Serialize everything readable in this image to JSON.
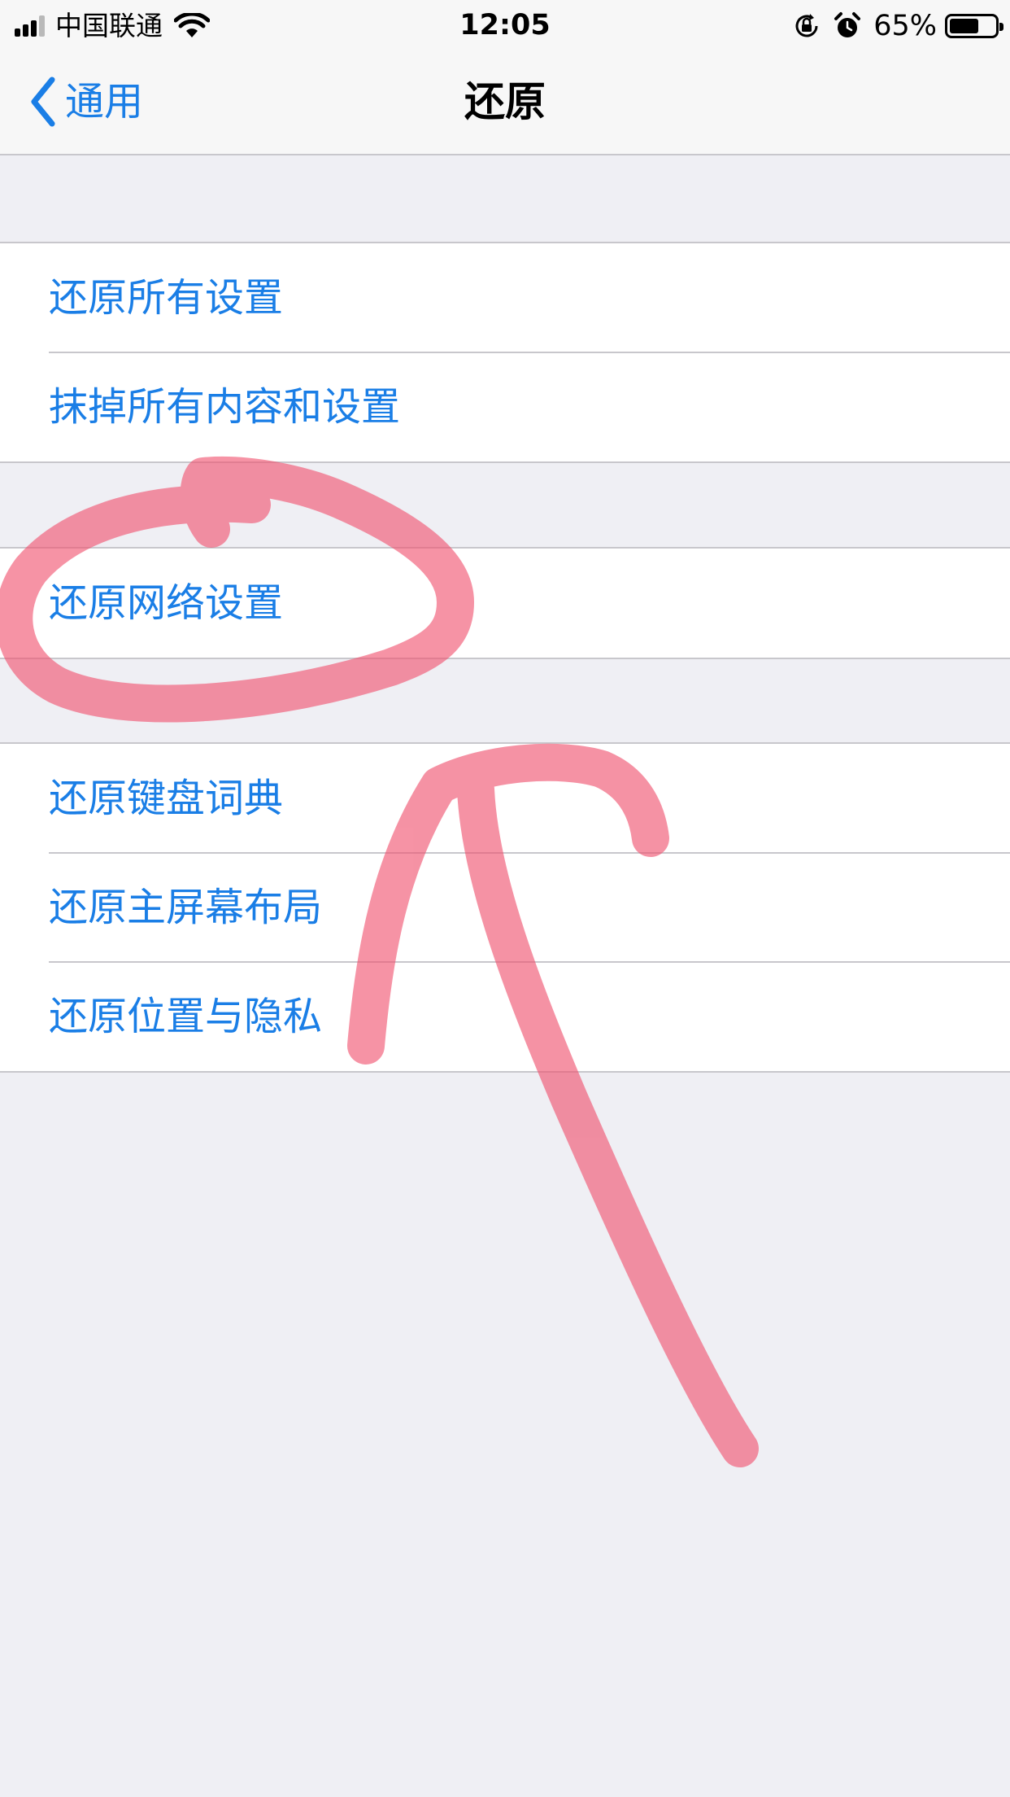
{
  "status_bar": {
    "carrier": "中国联通",
    "time": "12:05",
    "battery_percent": "65%",
    "battery_level": 0.65,
    "icons": [
      "signal-icon",
      "wifi-icon",
      "orientation-lock-icon",
      "alarm-icon",
      "battery-icon"
    ]
  },
  "nav": {
    "back_label": "通用",
    "title": "还原"
  },
  "groups": [
    {
      "items": [
        {
          "label": "还原所有设置"
        },
        {
          "label": "抹掉所有内容和设置"
        }
      ]
    },
    {
      "items": [
        {
          "label": "还原网络设置"
        }
      ]
    },
    {
      "items": [
        {
          "label": "还原键盘词典"
        },
        {
          "label": "还原主屏幕布局"
        },
        {
          "label": "还原位置与隐私"
        }
      ]
    }
  ],
  "colors": {
    "accent": "#1a7ee6",
    "background": "#efeff4",
    "annotation": "#f0506e"
  }
}
